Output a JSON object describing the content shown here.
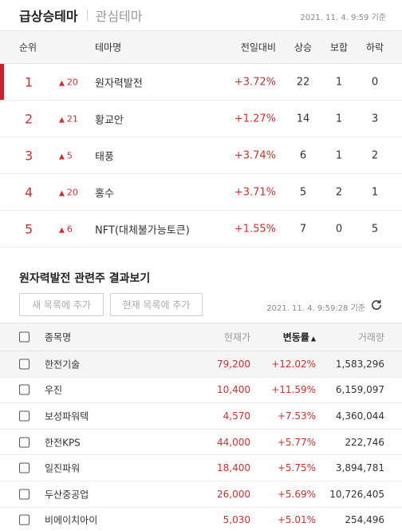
{
  "header": {
    "tab_active": "급상승테마",
    "tab_inactive": "관심테마",
    "timestamp": "2021. 11. 4. 9:59 기준"
  },
  "theme_table": {
    "columns": {
      "rank": "순위",
      "name": "테마명",
      "rate": "전일대비",
      "up": "상승",
      "flat": "보합",
      "down": "하락"
    },
    "rows": [
      {
        "rank": "1",
        "change": "20",
        "name": "원자력발전",
        "rate": "+3.72%",
        "up": "22",
        "flat": "1",
        "down": "0"
      },
      {
        "rank": "2",
        "change": "21",
        "name": "황교안",
        "rate": "+1.27%",
        "up": "14",
        "flat": "1",
        "down": "3"
      },
      {
        "rank": "3",
        "change": "5",
        "name": "태풍",
        "rate": "+3.74%",
        "up": "6",
        "flat": "1",
        "down": "2"
      },
      {
        "rank": "4",
        "change": "20",
        "name": "홍수",
        "rate": "+3.71%",
        "up": "5",
        "flat": "2",
        "down": "1"
      },
      {
        "rank": "5",
        "change": "6",
        "name": "NFT(대체불가능토큰)",
        "rate": "+1.55%",
        "up": "7",
        "flat": "0",
        "down": "5"
      }
    ]
  },
  "related": {
    "title": "원자력발전 관련주 결과보기",
    "btn_new": "새 목록에 추가",
    "btn_current": "현재 목록에 추가",
    "timestamp": "2021. 11. 4. 9:59:28 기준"
  },
  "stock_table": {
    "columns": {
      "name": "종목명",
      "price": "현재가",
      "rate": "변동률",
      "volume": "거래량"
    },
    "rows": [
      {
        "name": "한전기술",
        "price": "79,200",
        "rate": "+12.02%",
        "volume": "1,583,296"
      },
      {
        "name": "우진",
        "price": "10,400",
        "rate": "+11.59%",
        "volume": "6,159,097"
      },
      {
        "name": "보성파워텍",
        "price": "4,570",
        "rate": "+7.53%",
        "volume": "4,360,044"
      },
      {
        "name": "한전KPS",
        "price": "44,000",
        "rate": "+5.77%",
        "volume": "222,746"
      },
      {
        "name": "일진파워",
        "price": "18,400",
        "rate": "+5.75%",
        "volume": "3,894,781"
      },
      {
        "name": "두산중공업",
        "price": "26,000",
        "rate": "+5.69%",
        "volume": "10,726,405"
      },
      {
        "name": "비에이치아이",
        "price": "5,030",
        "rate": "+5.01%",
        "volume": "254,496"
      }
    ]
  },
  "colors": {
    "up_red": "#d32f2f",
    "accent_bar": "#c8242f"
  },
  "icons": {
    "rank_change": "up-triangle-icon",
    "refresh": "refresh-icon",
    "sort": "sort-up-icon"
  }
}
